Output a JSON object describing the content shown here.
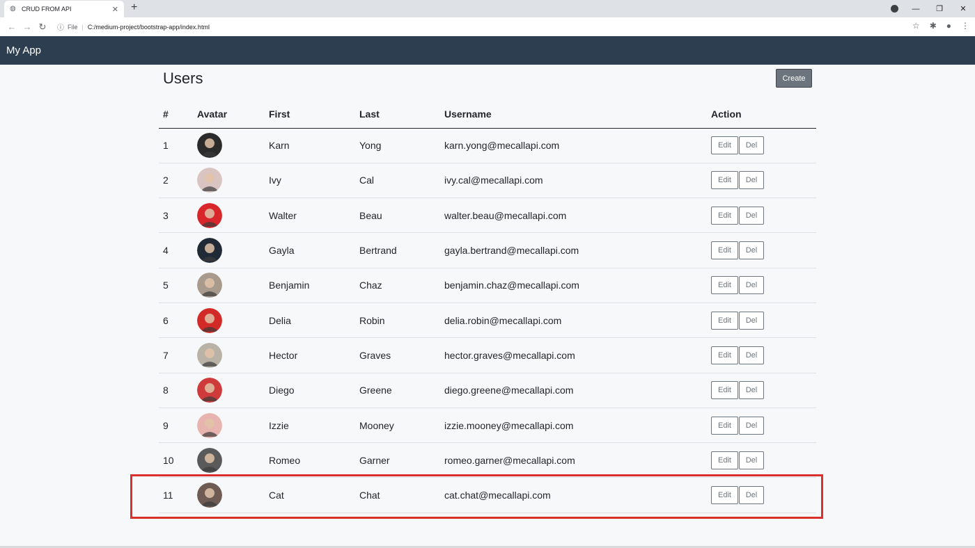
{
  "browser": {
    "tab_title": "CRUD FROM API",
    "tab_close": "✕",
    "new_tab": "+",
    "file_label": "File",
    "url": "C:/medium-project/bootstrap-app/index.html",
    "window_controls": {
      "minimize": "—",
      "restore": "❐",
      "close": "✕"
    }
  },
  "navbar": {
    "brand": "My App"
  },
  "page": {
    "title": "Users",
    "create_label": "Create"
  },
  "table": {
    "headers": {
      "num": "#",
      "avatar": "Avatar",
      "first": "First",
      "last": "Last",
      "username": "Username",
      "action": "Action"
    },
    "edit_label": "Edit",
    "del_label": "Del",
    "rows": [
      {
        "num": "1",
        "first": "Karn",
        "last": "Yong",
        "username": "karn.yong@mecallapi.com",
        "avatar_color": "#2b2b2b"
      },
      {
        "num": "2",
        "first": "Ivy",
        "last": "Cal",
        "username": "ivy.cal@mecallapi.com",
        "avatar_color": "#d9c4c2"
      },
      {
        "num": "3",
        "first": "Walter",
        "last": "Beau",
        "username": "walter.beau@mecallapi.com",
        "avatar_color": "#d8262a"
      },
      {
        "num": "4",
        "first": "Gayla",
        "last": "Bertrand",
        "username": "gayla.bertrand@mecallapi.com",
        "avatar_color": "#1f2a36"
      },
      {
        "num": "5",
        "first": "Benjamin",
        "last": "Chaz",
        "username": "benjamin.chaz@mecallapi.com",
        "avatar_color": "#a89a8c"
      },
      {
        "num": "6",
        "first": "Delia",
        "last": "Robin",
        "username": "delia.robin@mecallapi.com",
        "avatar_color": "#d22a26"
      },
      {
        "num": "7",
        "first": "Hector",
        "last": "Graves",
        "username": "hector.graves@mecallapi.com",
        "avatar_color": "#b9b2a6"
      },
      {
        "num": "8",
        "first": "Diego",
        "last": "Greene",
        "username": "diego.greene@mecallapi.com",
        "avatar_color": "#cf3a3a"
      },
      {
        "num": "9",
        "first": "Izzie",
        "last": "Mooney",
        "username": "izzie.mooney@mecallapi.com",
        "avatar_color": "#e8b4b0"
      },
      {
        "num": "10",
        "first": "Romeo",
        "last": "Garner",
        "username": "romeo.garner@mecallapi.com",
        "avatar_color": "#5a5a5a"
      },
      {
        "num": "11",
        "first": "Cat",
        "last": "Chat",
        "username": "cat.chat@mecallapi.com",
        "avatar_color": "#6e5c54"
      }
    ]
  },
  "colors": {
    "navbar": "#2d3e50",
    "highlight": "#d9302c",
    "create_button": "#6c757d"
  }
}
